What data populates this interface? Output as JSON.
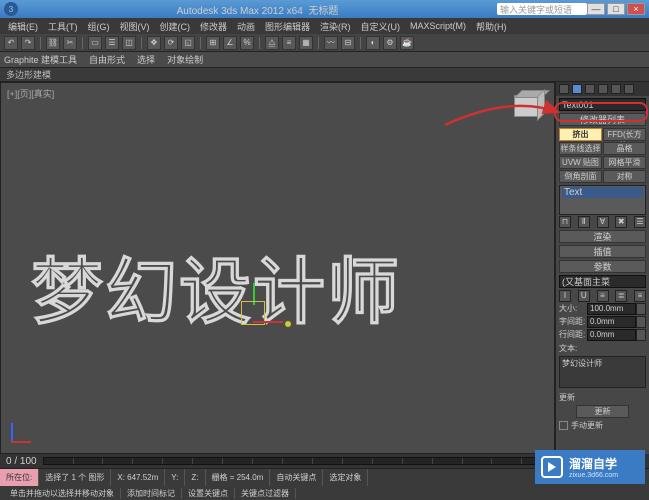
{
  "titlebar": {
    "app": "Autodesk 3ds Max 2012 x64",
    "doc": "无标题",
    "search_ph": "输入关键字或短语"
  },
  "menu": {
    "m0": "编辑(E)",
    "m1": "工具(T)",
    "m2": "组(G)",
    "m3": "视图(V)",
    "m4": "创建(C)",
    "m5": "修改器",
    "m6": "动画",
    "m7": "图形编辑器",
    "m8": "渲染(R)",
    "m9": "自定义(U)",
    "m10": "MAXScript(M)",
    "m11": "帮助(H)"
  },
  "ribbon": {
    "r0": "Graphite 建模工具",
    "r1": "自由形式",
    "r2": "选择",
    "r3": "对象绘制"
  },
  "tabbar": {
    "t0": "多边形建模"
  },
  "viewport": {
    "label": "[+][页][真实]",
    "text": "梦幻设计师"
  },
  "side": {
    "obj": "Text001",
    "modlist_hdr": "修改器列表",
    "btn_extrude": "挤出",
    "btn_ffd": "FFD(长方体)",
    "btn_spline": "样条线选择",
    "btn_lattice": "晶格",
    "btn_uvw": "UVW 贴图",
    "btn_mesh": "网格平滑",
    "btn_chamfer": "倒角剖面",
    "btn_sym": "对称",
    "stack_item": "Text",
    "roll_render": "渲染",
    "roll_interp": "插值",
    "roll_params": "参数",
    "font_label": "(又基面主菜",
    "size_lbl": "大小:",
    "size_val": "100.0mm",
    "kern_lbl": "字间距:",
    "kern_val": "0.0mm",
    "lead_lbl": "行间距:",
    "lead_val": "0.0mm",
    "text_lbl": "文本:",
    "text_val": "梦幻设计师",
    "update_hdr": "更新",
    "update_btn": "更新",
    "manual": "手动更新"
  },
  "timeline": {
    "range": "0 / 100"
  },
  "status": {
    "sel": "选择了 1 个 图形",
    "x": "X: 647.52m",
    "y": "Y:",
    "z": "Z:",
    "grid": "栅格 = 254.0m",
    "auto": "自动关键点",
    "selected": "选定对象",
    "hint": "单击并拖动以选择并移动对象",
    "now": "所在位:",
    "add": "添加时间标记",
    "key": "设置关键点",
    "filter": "关键点过滤器"
  },
  "watermark": {
    "brand": "溜溜自学",
    "url": "zixue.3d66.com"
  }
}
